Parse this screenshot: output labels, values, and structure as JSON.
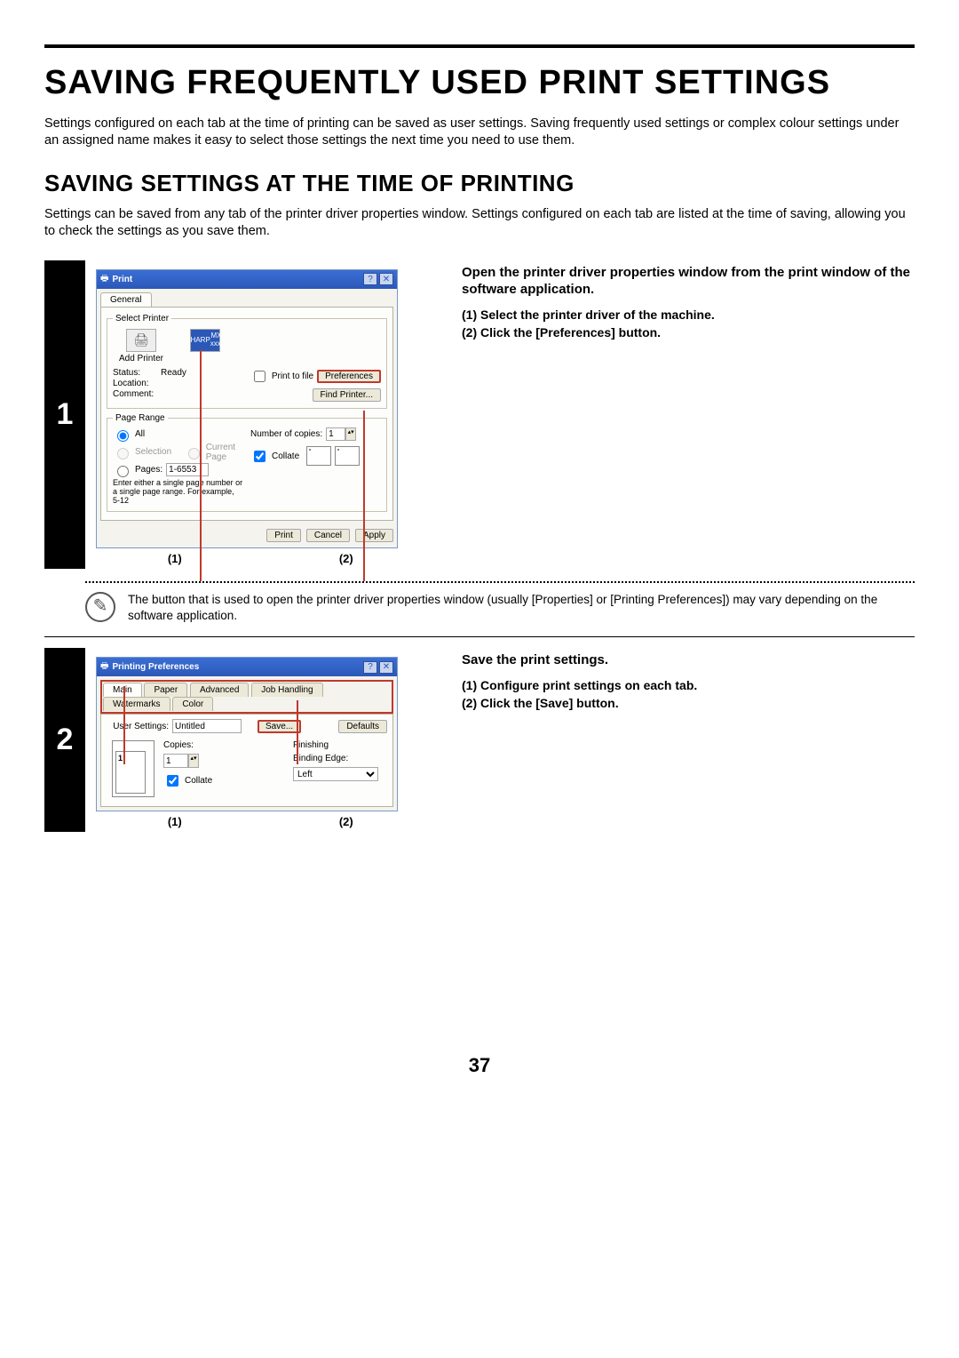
{
  "main_title": "SAVING FREQUENTLY USED PRINT SETTINGS",
  "intro": "Settings configured on each tab at the time of printing can be saved as user settings. Saving frequently used settings or complex colour settings under an assigned name makes it easy to select those settings the next time you need to use them.",
  "subtitle": "SAVING SETTINGS AT THE TIME OF PRINTING",
  "sub_intro": "Settings can be saved from any tab of the printer driver properties window. Settings configured on each tab are listed at the time of saving, allowing you to check the settings as you save them.",
  "page_number": "37",
  "step1": {
    "num": "1",
    "lead": "Open the printer driver properties window from the print window of the software application.",
    "items": [
      "Select the printer driver of the machine.",
      "Click the [Preferences] button."
    ],
    "callout_1": "(1)",
    "callout_2": "(2)"
  },
  "note_text": "The button that is used to open the printer driver properties window (usually [Properties] or [Printing Preferences]) may vary depending on the software application.",
  "step2": {
    "num": "2",
    "lead": "Save the print settings.",
    "items": [
      "Configure print settings on each tab.",
      "Click the [Save] button."
    ],
    "callout_1": "(1)",
    "callout_2": "(2)"
  },
  "print_dialog": {
    "title": "Print",
    "tab_general": "General",
    "grp_select_printer": "Select Printer",
    "add_printer": "Add Printer",
    "sel_printer_line1": "SHARP",
    "sel_printer_line2": "MX-xxxx",
    "status_lbl": "Status:",
    "status_val": "Ready",
    "location_lbl": "Location:",
    "comment_lbl": "Comment:",
    "print_to_file": "Print to file",
    "preferences_btn": "Preferences",
    "find_printer_btn": "Find Printer...",
    "grp_page_range": "Page Range",
    "opt_all": "All",
    "opt_selection": "Selection",
    "opt_current": "Current Page",
    "opt_pages": "Pages:",
    "pages_value": "1-6553",
    "pages_hint": "Enter either a single page number or a single page range.  For example, 5-12",
    "copies_lbl": "Number of copies:",
    "copies_val": "1",
    "collate_lbl": "Collate",
    "btn_print": "Print",
    "btn_cancel": "Cancel",
    "btn_apply": "Apply"
  },
  "pref_dialog": {
    "title": "Printing Preferences",
    "tabs": [
      "Main",
      "Paper",
      "Advanced",
      "Job Handling",
      "Watermarks",
      "Color"
    ],
    "user_settings_lbl": "User Settings:",
    "user_settings_val": "Untitled",
    "save_btn": "Save...",
    "defaults_btn": "Defaults",
    "copies_lbl": "Copies:",
    "copies_val": "1",
    "collate_lbl": "Collate",
    "finishing_lbl": "Finishing",
    "binding_lbl": "Binding Edge:",
    "binding_val": "Left",
    "thumb_num": "1"
  }
}
